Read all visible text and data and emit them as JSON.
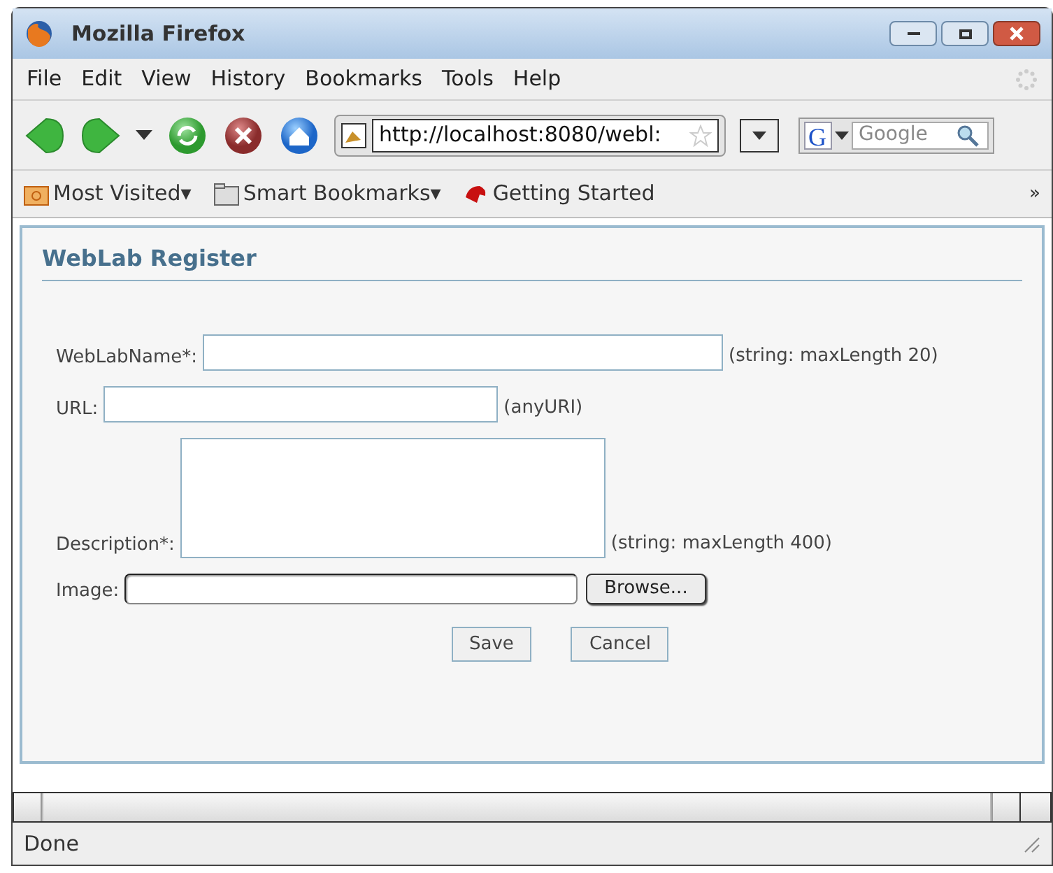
{
  "window": {
    "title": "Mozilla Firefox"
  },
  "menu": [
    "File",
    "Edit",
    "View",
    "History",
    "Bookmarks",
    "Tools",
    "Help"
  ],
  "address": {
    "value": "http://localhost:8080/webl:"
  },
  "search": {
    "engine_logo": "G",
    "placeholder": "Google"
  },
  "bookmarks": [
    {
      "label": "Most Visited▾",
      "kind": "smart"
    },
    {
      "label": "Smart Bookmarks▾",
      "kind": "folder"
    },
    {
      "label": "Getting Started",
      "kind": "page"
    }
  ],
  "bookmarks_overflow": "»",
  "page": {
    "heading": "WebLab Register",
    "fields": [
      {
        "kind": "text",
        "label": "WebLabName*:",
        "hint": "(string: maxLength 20)"
      },
      {
        "kind": "text",
        "label": "URL:",
        "hint": "(anyURI)"
      },
      {
        "kind": "textarea",
        "label": "Description*:",
        "hint": "(string: maxLength 400)"
      },
      {
        "kind": "file",
        "label": "Image:",
        "button": "Browse..."
      }
    ],
    "buttons": [
      "Save",
      "Cancel"
    ]
  },
  "status_bar": "Done"
}
